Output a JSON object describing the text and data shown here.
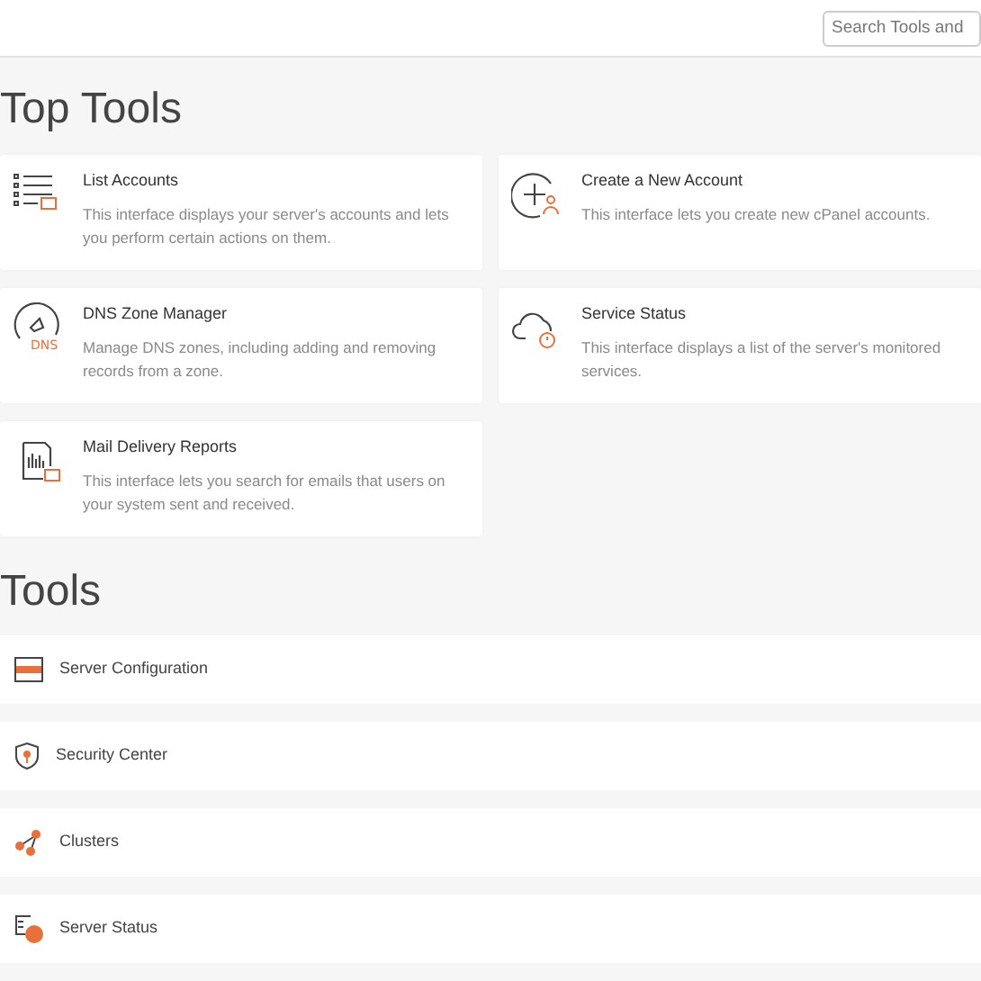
{
  "search": {
    "placeholder": "Search Tools and"
  },
  "top_tools": {
    "title": "Top Tools",
    "cards": [
      {
        "kind": "list",
        "title": "List Accounts",
        "description": "This interface displays your server's accounts and lets you perform certain actions on them."
      },
      {
        "kind": "add",
        "title": "Create a New Account",
        "description": "This interface lets you create new cPanel accounts."
      },
      {
        "kind": "dns",
        "icon_text": "DNS",
        "title": "DNS Zone Manager",
        "description": "Manage DNS zones, including adding and removing records from a zone."
      },
      {
        "kind": "cloud",
        "title": "Service Status",
        "description": "This interface displays a list of the server's monitored services."
      },
      {
        "kind": "mail",
        "title": "Mail Delivery Reports",
        "description": "This interface lets you search for emails that users on your system sent and received."
      }
    ]
  },
  "tools": {
    "title": "Tools",
    "items": [
      {
        "kind": "server",
        "label": "Server Configuration"
      },
      {
        "kind": "shield",
        "label": "Security Center"
      },
      {
        "kind": "cluster",
        "label": "Clusters"
      },
      {
        "kind": "status",
        "label": "Server Status"
      }
    ]
  }
}
